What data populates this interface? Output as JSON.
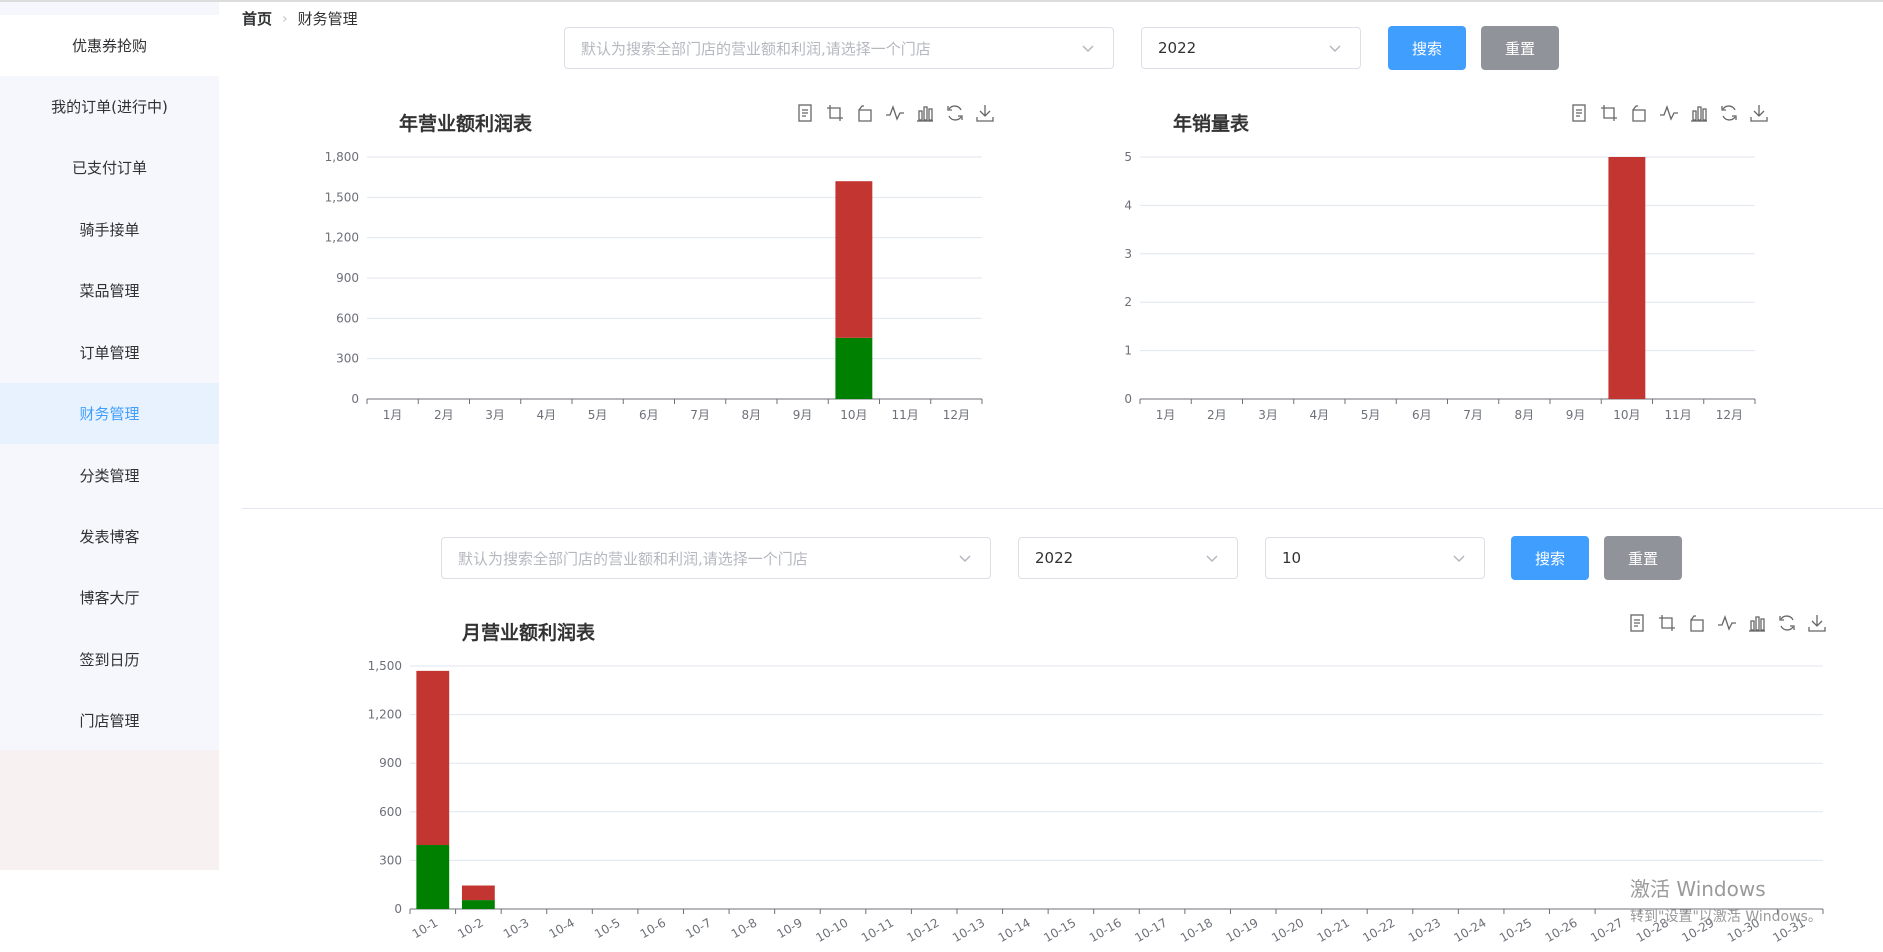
{
  "sidebar": {
    "items": [
      {
        "label": "优惠券抢购"
      },
      {
        "label": "我的订单(进行中)"
      },
      {
        "label": "已支付订单"
      },
      {
        "label": "骑手接单"
      },
      {
        "label": "菜品管理"
      },
      {
        "label": "订单管理"
      },
      {
        "label": "财务管理"
      },
      {
        "label": "分类管理"
      },
      {
        "label": "发表博客"
      },
      {
        "label": "博客大厅"
      },
      {
        "label": "签到日历"
      },
      {
        "label": "门店管理"
      }
    ],
    "active_index": 6
  },
  "breadcrumb": {
    "home": "首页",
    "current": "财务管理"
  },
  "year_filter": {
    "store_placeholder": "默认为搜索全部门店的营业额和利润,请选择一个门店",
    "year_value": "2022",
    "search_label": "搜索",
    "reset_label": "重置"
  },
  "month_filter": {
    "store_placeholder": "默认为搜索全部门店的营业额和利润,请选择一个门店",
    "year_value": "2022",
    "month_value": "10",
    "search_label": "搜索",
    "reset_label": "重置"
  },
  "toolbox_icons": [
    "data-view-icon",
    "zoom-icon",
    "zoom-reset-icon",
    "line-chart-icon",
    "bar-chart-icon",
    "restore-icon",
    "download-icon"
  ],
  "colors": {
    "red": "#c23531",
    "green": "#008000",
    "accent": "#409eff",
    "gray_button": "#909399"
  },
  "watermark": {
    "line1": "激活 Windows",
    "line2": "转到\"设置\"以激活 Windows。"
  },
  "chart_data": [
    {
      "id": "yearRevenue",
      "type": "bar",
      "stacked": true,
      "title": "年营业额利润表",
      "categories": [
        "1月",
        "2月",
        "3月",
        "4月",
        "5月",
        "6月",
        "7月",
        "8月",
        "9月",
        "10月",
        "11月",
        "12月"
      ],
      "yticks": [
        "0",
        "300",
        "600",
        "900",
        "1,200",
        "1,500",
        "1,800"
      ],
      "ylim": [
        0,
        1800
      ],
      "series": [
        {
          "color": "#008000",
          "values": [
            0,
            0,
            0,
            0,
            0,
            0,
            0,
            0,
            0,
            455,
            0,
            0
          ]
        },
        {
          "color": "#c23531",
          "values": [
            0,
            0,
            0,
            0,
            0,
            0,
            0,
            0,
            0,
            1165,
            0,
            0
          ]
        }
      ],
      "grid": true
    },
    {
      "id": "yearSales",
      "type": "bar",
      "stacked": false,
      "title": "年销量表",
      "categories": [
        "1月",
        "2月",
        "3月",
        "4月",
        "5月",
        "6月",
        "7月",
        "8月",
        "9月",
        "10月",
        "11月",
        "12月"
      ],
      "yticks": [
        "0",
        "1",
        "2",
        "3",
        "4",
        "5"
      ],
      "ylim": [
        0,
        5
      ],
      "series": [
        {
          "color": "#c23531",
          "values": [
            0,
            0,
            0,
            0,
            0,
            0,
            0,
            0,
            0,
            5,
            0,
            0
          ]
        }
      ],
      "grid": true
    },
    {
      "id": "monthRevenue",
      "type": "bar",
      "stacked": true,
      "title": "月营业额利润表",
      "categories": [
        "10-1",
        "10-2",
        "10-3",
        "10-4",
        "10-5",
        "10-6",
        "10-7",
        "10-8",
        "10-9",
        "10-10",
        "10-11",
        "10-12",
        "10-13",
        "10-14",
        "10-15",
        "10-16",
        "10-17",
        "10-18",
        "10-19",
        "10-20",
        "10-21",
        "10-22",
        "10-23",
        "10-24",
        "10-25",
        "10-26",
        "10-27",
        "10-28",
        "10-29",
        "10-30",
        "10-31"
      ],
      "yticks": [
        "0",
        "300",
        "600",
        "900",
        "1,200",
        "1,500"
      ],
      "ylim": [
        0,
        1500
      ],
      "series": [
        {
          "color": "#008000",
          "values": [
            395,
            55,
            0,
            0,
            0,
            0,
            0,
            0,
            0,
            0,
            0,
            0,
            0,
            0,
            0,
            0,
            0,
            0,
            0,
            0,
            0,
            0,
            0,
            0,
            0,
            0,
            0,
            0,
            0,
            0,
            0
          ]
        },
        {
          "color": "#c23531",
          "values": [
            1075,
            90,
            0,
            0,
            0,
            0,
            0,
            0,
            0,
            0,
            0,
            0,
            0,
            0,
            0,
            0,
            0,
            0,
            0,
            0,
            0,
            0,
            0,
            0,
            0,
            0,
            0,
            0,
            0,
            0,
            0
          ]
        }
      ],
      "grid": true
    }
  ]
}
